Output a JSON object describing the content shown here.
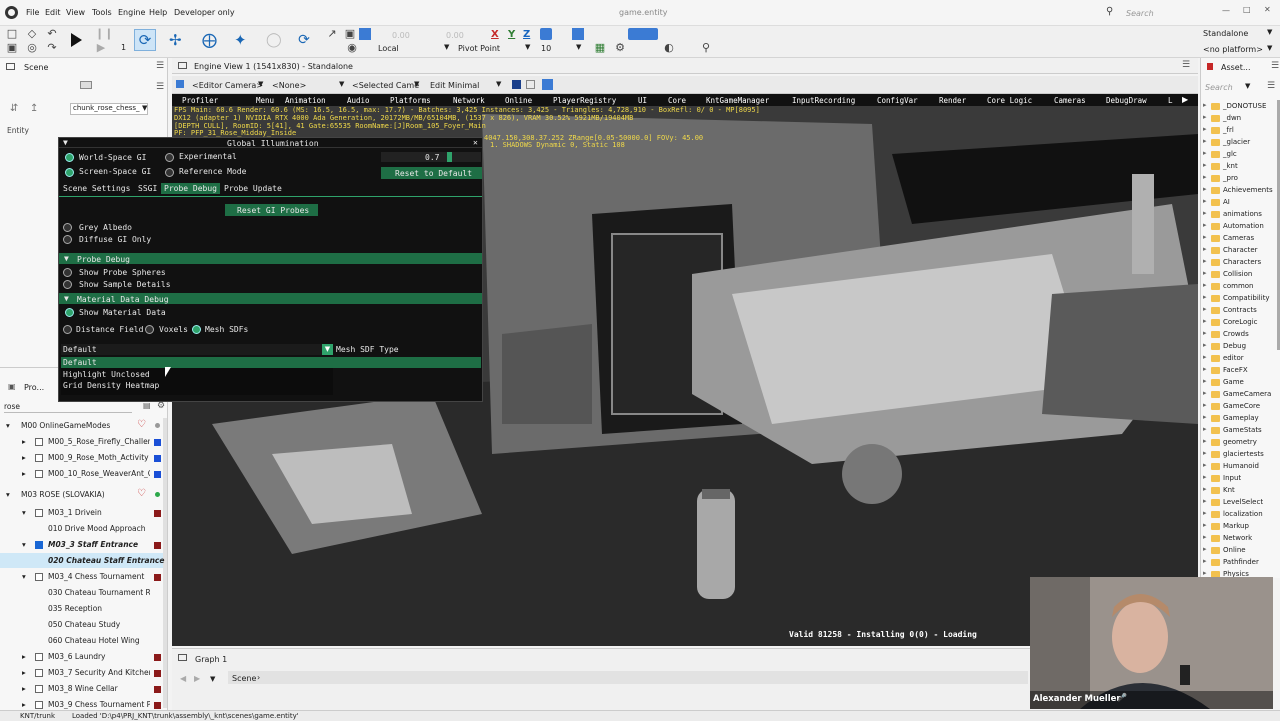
{
  "app": {
    "title": "game.entity"
  },
  "menu": [
    "File",
    "Edit",
    "View",
    "Tools",
    "Engine",
    "Help",
    "Developer only"
  ],
  "search": {
    "placeholder": "Search"
  },
  "toolbar": {
    "undo_value_a": "0.00",
    "redo_value_b": "0.00",
    "space_dropdown": "Local",
    "pivot_dropdown": "Pivot Point",
    "snap_value": "10",
    "axis_x": "X",
    "axis_y": "Y",
    "axis_z": "Z",
    "counter": "1"
  },
  "platform": {
    "mode": "Standalone",
    "platform": "<no platform>"
  },
  "left": {
    "scene_tab": "Scene",
    "entity_label": "Entity",
    "filter_value": "chunk_rose_chess_",
    "search_value": "rose",
    "project_tab": "Pro..."
  },
  "tree": [
    {
      "label": "M00 OnlineGameModes",
      "color": "#c62828"
    },
    {
      "label": "M00_5_Rose_Firefly_Challeng",
      "color": "#1a4fd6"
    },
    {
      "label": "M00_9_Rose_Moth_Activity",
      "color": "#1a4fd6"
    },
    {
      "label": "M00_10_Rose_WeaverAnt_O",
      "color": "#1a4fd6"
    },
    {
      "label": "M03 ROSE (SLOVAKIA)",
      "color": "#2ca84a"
    },
    {
      "label": "M03_1 Drivein",
      "color": "#8b1a1a"
    },
    {
      "label": "010 Drive Mood Approach",
      "color": ""
    },
    {
      "label": "M03_3 Staff Entrance",
      "color": "#8b1a1a"
    },
    {
      "label": "020 Chateau Staff Entrance",
      "color": ""
    },
    {
      "label": "M03_4 Chess Tournament",
      "color": "#8b1a1a"
    },
    {
      "label": "030 Chateau Tournament Re",
      "color": ""
    },
    {
      "label": "035 Reception",
      "color": ""
    },
    {
      "label": "050 Chateau Study",
      "color": ""
    },
    {
      "label": "060 Chateau Hotel Wing",
      "color": ""
    },
    {
      "label": "M03_6 Laundry",
      "color": "#8b1a1a"
    },
    {
      "label": "M03_7 Security And Kitchen",
      "color": "#8b1a1a"
    },
    {
      "label": "M03_8 Wine Cellar",
      "color": "#8b1a1a"
    },
    {
      "label": "M03_9 Chess Tournament Po",
      "color": "#8b1a1a"
    }
  ],
  "viewport": {
    "title": "Engine View 1 (1541x830) - Standalone",
    "camera_dropdown": "<Editor Camera>",
    "none_dropdown": "<None>",
    "selected_dropdown": "<Selected Came",
    "edit_dropdown": "Edit Minimal",
    "debug_menu": [
      "Profiler",
      "Menu",
      "Animation",
      "Audio",
      "Platforms",
      "Network",
      "Online",
      "PlayerRegistry",
      "UI",
      "Core",
      "KntGameManager",
      "InputRecording",
      "ConfigVar",
      "Render",
      "Core Logic",
      "Cameras",
      "DebugDraw",
      "L"
    ],
    "stats_line1": "FPS Main: 60.6  Render: 60.6 (MS: 16.5, 16.5, max: 17.7) - Batches: 3,425 Instances: 3,425 - Triangles: 4,728,910 - BoxRefl:    0/    0 - MP[8095]",
    "stats_line2": "DX12 (adapter 1) NVIDIA RTX 4000 Ada Generation, 20172MB/MB/65104MB, (1537 x 826), VRAM 30.52% 5921MB/19404MB",
    "stats_line3": "[DEPTH CULL], RoomID: 5[41], 41 Gate:65535 RoomName:[J]Room_105_Foyer_Main",
    "stats_line4": "PF: PFP_31_Rose_Midday_Inside",
    "stats_line5": "4047.150,308.37.252 ZRange[0.05-50000.0] FOVy: 45.00",
    "stats_line6": "1. SHADOWS Dynamic 0, Static 108",
    "status_text": "Valid 81258 - Installing 0(0) - Loading"
  },
  "gi": {
    "title": "Global Illumination",
    "world_space_gi": "World-Space GI",
    "experimental": "Experimental",
    "value": "0.7",
    "screen_space_gi": "Screen-Space GI",
    "reference_mode": "Reference Mode",
    "reset_default": "Reset to Default",
    "tabs": [
      "Scene Settings",
      "SSGI",
      "Probe Debug",
      "Probe Update"
    ],
    "reset_probes": "Reset GI Probes",
    "grey_albedo": "Grey Albedo",
    "diffuse_only": "Diffuse GI Only",
    "probe_debug_header": "Probe Debug",
    "show_probe_spheres": "Show Probe Spheres",
    "show_sample_details": "Show Sample Details",
    "material_header": "Material Data Debug",
    "show_material": "Show Material Data",
    "distance_field": "Distance Field",
    "voxels": "Voxels",
    "mesh_sdfs": "Mesh SDFs",
    "combo_value": "Default",
    "combo_label": "Mesh SDF Type",
    "options": [
      "Default",
      "Highlight Unclosed",
      "Grid Density Heatmap"
    ]
  },
  "graph": {
    "tab": "Graph 1",
    "breadcrumb": "Scene"
  },
  "right": {
    "tab": "Asset...",
    "search_placeholder": "Search",
    "folders": [
      "_DONOTUSE",
      "_dwn",
      "_frl",
      "_glacier",
      "_glc",
      "_knt",
      "_pro",
      "Achievements",
      "AI",
      "animations",
      "Automation",
      "Cameras",
      "Character",
      "Characters",
      "Collision",
      "common",
      "Compatibility",
      "Contracts",
      "CoreLogic",
      "Crowds",
      "Debug",
      "editor",
      "FaceFX",
      "Game",
      "GameCamera",
      "GameCore",
      "Gameplay",
      "GameStats",
      "geometry",
      "glaciertests",
      "Humanoid",
      "Input",
      "Knt",
      "LevelSelect",
      "localization",
      "Markup",
      "Network",
      "Online",
      "Pathfinder",
      "Physics"
    ]
  },
  "status": {
    "branch": "KNT/trunk",
    "message": "Loaded 'D:\\p4\\PRJ_KNT\\trunk\\assembly\\_knt\\scenes\\game.entity'"
  },
  "webcam": {
    "name": "Alexander Mueller"
  },
  "colors": {
    "accent": "#1e6e45",
    "selection": "#cfe8f7",
    "viewport_bg": "#2b2b2b"
  }
}
